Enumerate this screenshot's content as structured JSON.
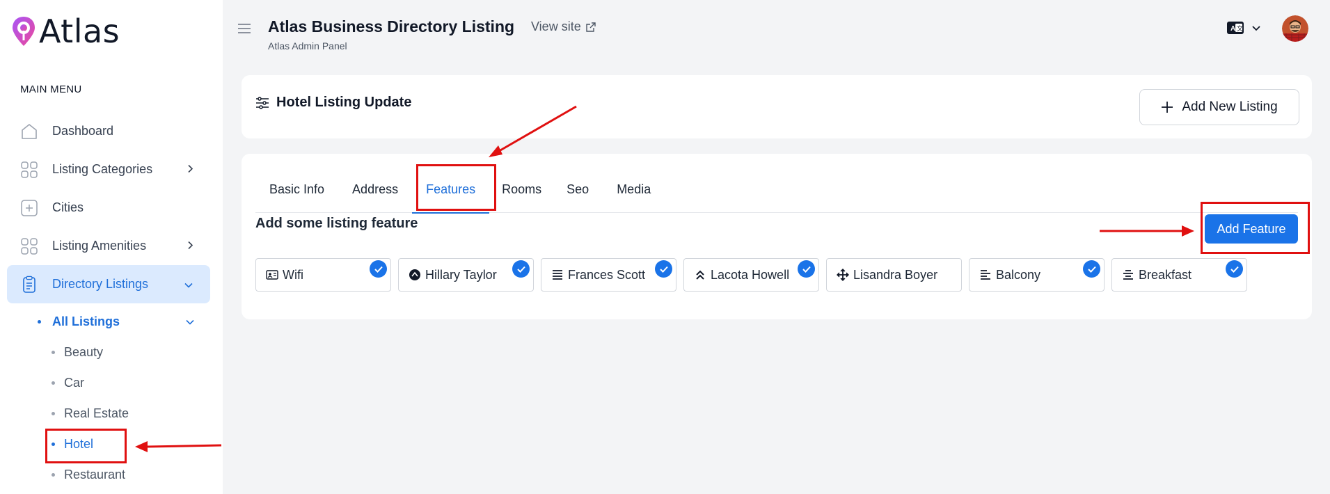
{
  "brand": {
    "name": "Atlas"
  },
  "sidebar": {
    "heading": "MAIN MENU",
    "items": [
      {
        "label": "Dashboard",
        "icon": "home-icon"
      },
      {
        "label": "Listing Categories",
        "icon": "grid-icon",
        "expandable": true
      },
      {
        "label": "Cities",
        "icon": "plus-square-icon"
      },
      {
        "label": "Listing Amenities",
        "icon": "grid-icon",
        "expandable": true
      },
      {
        "label": "Directory Listings",
        "icon": "clipboard-icon",
        "expandable": true,
        "active": true
      }
    ],
    "sub": {
      "label": "All Listings"
    },
    "sub_items": [
      "Beauty",
      "Car",
      "Real Estate",
      "Hotel",
      "Restaurant"
    ],
    "active_sub_item": "Hotel"
  },
  "header": {
    "title": "Atlas Business Directory Listing",
    "subtitle": "Atlas Admin Panel",
    "view_site": "View site"
  },
  "page": {
    "title": "Hotel Listing Update",
    "add_new_label": "Add New Listing"
  },
  "tabs": [
    "Basic Info",
    "Address",
    "Features",
    "Rooms",
    "Seo",
    "Media"
  ],
  "active_tab": "Features",
  "features_section": {
    "title": "Add some listing feature",
    "add_button": "Add Feature",
    "items": [
      {
        "label": "Wifi",
        "icon": "id-card-icon",
        "checked": true
      },
      {
        "label": "Hillary Taylor",
        "icon": "circle-caret-icon",
        "checked": true
      },
      {
        "label": "Frances Scott",
        "icon": "list-icon",
        "checked": true
      },
      {
        "label": "Lacota Howell",
        "icon": "double-up-icon",
        "checked": true
      },
      {
        "label": "Lisandra Boyer",
        "icon": "move-arrows-icon",
        "checked": false
      },
      {
        "label": "Balcony",
        "icon": "align-left-icon",
        "checked": true
      },
      {
        "label": "Breakfast",
        "icon": "align-center-icon",
        "checked": true
      }
    ]
  },
  "colors": {
    "accent": "#1a73e8",
    "annotation": "#e01010",
    "active_bg": "#dbeafe"
  }
}
